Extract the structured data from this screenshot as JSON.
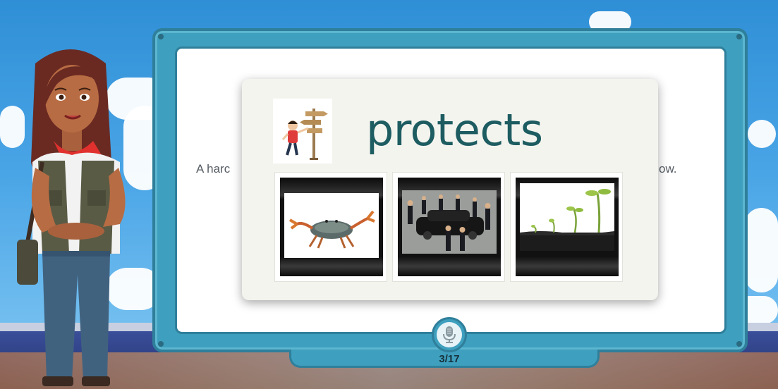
{
  "lesson": {
    "background_text_left": "A harc",
    "background_text_right": "ow."
  },
  "card": {
    "word": "protects",
    "word_icon": "boy-with-signpost-illustration",
    "choices": [
      {
        "name": "crab",
        "icon": "crab-photo"
      },
      {
        "name": "bodyguards-car",
        "icon": "bodyguards-escorting-car-photo"
      },
      {
        "name": "sprouts",
        "icon": "plant-sprouts-photo"
      }
    ]
  },
  "controls": {
    "mic_icon": "microphone-icon",
    "page_counter": "3/17"
  },
  "colors": {
    "board": "#3e9fbe",
    "word": "#1d5c61",
    "sky": "#4aa5e6"
  }
}
